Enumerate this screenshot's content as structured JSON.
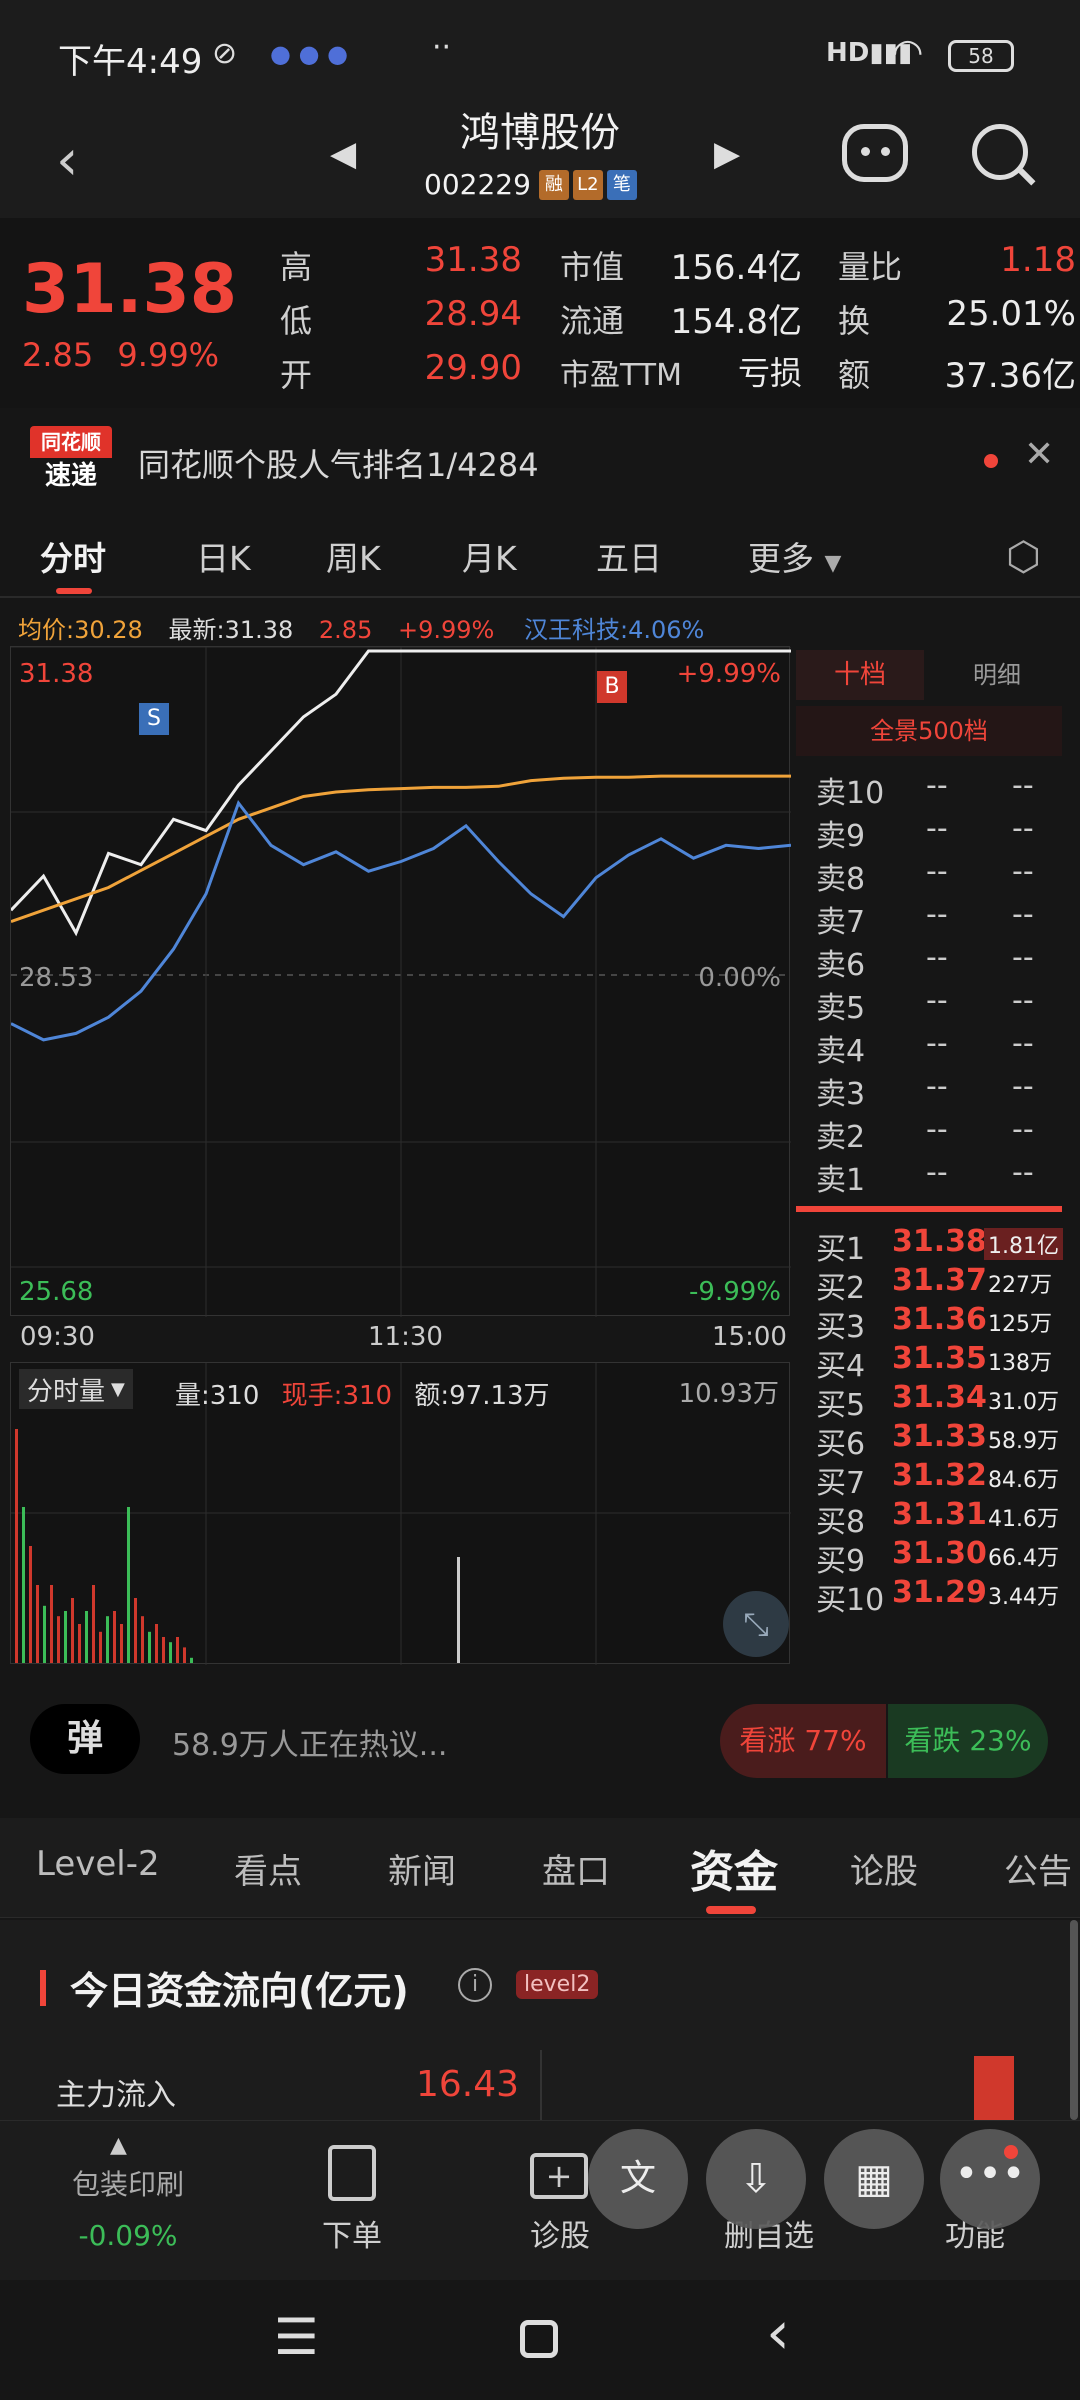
{
  "status": {
    "time": "下午4:49",
    "battery": "58"
  },
  "header": {
    "title": "鸿博股份",
    "code": "002229",
    "tags": [
      "融",
      "L2",
      "笔"
    ]
  },
  "quote": {
    "price": "31.38",
    "change": "2.85",
    "change_pct": "9.99%",
    "stats": [
      {
        "label": "高",
        "value": "31.38"
      },
      {
        "label": "低",
        "value": "28.94"
      },
      {
        "label": "开",
        "value": "29.90"
      },
      {
        "label": "市值",
        "value": "156.4亿"
      },
      {
        "label": "流通",
        "value": "154.8亿"
      },
      {
        "label": "市盈TTM",
        "value": "亏损"
      },
      {
        "label": "量比",
        "value": "1.18"
      },
      {
        "label": "换",
        "value": "25.01%"
      },
      {
        "label": "额",
        "value": "37.36亿"
      }
    ]
  },
  "banner": {
    "logo_top": "同花顺",
    "logo_bottom": "速递",
    "text": "同花顺个股人气排名1/4284"
  },
  "tabs": [
    "分时",
    "日K",
    "周K",
    "月K",
    "五日",
    "更多"
  ],
  "chart_info": {
    "avg_label": "均价:",
    "avg": "30.28",
    "latest_label": "最新:",
    "latest": "31.38",
    "chg": "2.85",
    "chg_pct": "+9.99%",
    "related": "汉王科技:",
    "related_pct": "4.06%"
  },
  "chart_data": {
    "type": "line",
    "y_top_label": "31.38",
    "y_mid_label": "28.53",
    "y_bottom_label": "25.68",
    "pct_top": "+9.99%",
    "pct_mid": "0.00%",
    "pct_bottom": "-9.99%",
    "x_ticks": [
      "09:30",
      "11:30",
      "15:00"
    ],
    "markers": [
      "S",
      "B"
    ],
    "ylim": [
      25.68,
      31.38
    ],
    "series": [
      {
        "color": "#eeeeee",
        "values": [
          29.1,
          29.4,
          28.9,
          29.6,
          29.5,
          29.9,
          29.8,
          30.2,
          30.5,
          30.8,
          31.0,
          31.38,
          31.38,
          31.38,
          31.38,
          31.38,
          31.38,
          31.38,
          31.38,
          31.38,
          31.38,
          31.38,
          31.38,
          31.38,
          31.38
        ]
      },
      {
        "color": "#f0a33a",
        "values": [
          29.0,
          29.1,
          29.2,
          29.3,
          29.45,
          29.6,
          29.75,
          29.9,
          30.0,
          30.1,
          30.14,
          30.16,
          30.17,
          30.18,
          30.18,
          30.19,
          30.24,
          30.26,
          30.27,
          30.27,
          30.28,
          30.28,
          30.28,
          30.28,
          30.28
        ]
      }
    ],
    "pct_series": {
      "color": "#4f86d8",
      "values": [
        -1.5,
        -2.0,
        -1.8,
        -1.3,
        -0.5,
        0.8,
        2.5,
        5.3,
        4.0,
        3.4,
        3.8,
        3.2,
        3.5,
        3.9,
        4.6,
        3.5,
        2.5,
        1.8,
        3.0,
        3.7,
        4.2,
        3.6,
        4.0,
        3.9,
        4.0
      ]
    }
  },
  "volume": {
    "label": "分时量",
    "vol_label": "量:",
    "vol": "310",
    "hand_label": "现手:",
    "hand": "310",
    "amount_label": "额:",
    "amount": "97.13万",
    "max": "10.93万",
    "bars": [
      0.9,
      0.6,
      0.45,
      0.3,
      0.22,
      0.3,
      0.18,
      0.2,
      0.25,
      0.15,
      0.2,
      0.3,
      0.12,
      0.18,
      0.2,
      0.15,
      0.6,
      0.25,
      0.18,
      0.12,
      0.15,
      0.1,
      0.08,
      0.1,
      0.06,
      0.02
    ]
  },
  "book": {
    "tab_active": "十档",
    "tab_other": "明细",
    "panorama": "全景500档",
    "sells": [
      "卖10",
      "卖9",
      "卖8",
      "卖7",
      "卖6",
      "卖5",
      "卖4",
      "卖3",
      "卖2",
      "卖1"
    ],
    "empty": "--",
    "buys": [
      {
        "label": "买1",
        "price": "31.38",
        "vol": "1.81亿"
      },
      {
        "label": "买2",
        "price": "31.37",
        "vol": "227万"
      },
      {
        "label": "买3",
        "price": "31.36",
        "vol": "125万"
      },
      {
        "label": "买4",
        "price": "31.35",
        "vol": "138万"
      },
      {
        "label": "买5",
        "price": "31.34",
        "vol": "31.0万"
      },
      {
        "label": "买6",
        "price": "31.33",
        "vol": "58.9万"
      },
      {
        "label": "买7",
        "price": "31.32",
        "vol": "84.6万"
      },
      {
        "label": "买8",
        "price": "31.31",
        "vol": "41.6万"
      },
      {
        "label": "买9",
        "price": "31.30",
        "vol": "66.4万"
      },
      {
        "label": "买10",
        "price": "31.29",
        "vol": "3.44万"
      }
    ]
  },
  "hot": {
    "badge": "弹",
    "text": "58.9万人正在热议...",
    "bull": "看涨 77%",
    "bear": "看跌 23%"
  },
  "bottom_tabs": [
    "Level-2",
    "看点",
    "新闻",
    "盘口",
    "资金",
    "论股",
    "公告"
  ],
  "fund": {
    "title": "今日资金流向(亿元)",
    "badge": "level2",
    "row_label": "主力流入",
    "row_value": "16.43"
  },
  "toolbar": {
    "sector": "包装印刷",
    "sector_chg": "-0.09%",
    "order": "下单",
    "diagnose": "诊股",
    "remove": "删自选",
    "function": "功能"
  }
}
